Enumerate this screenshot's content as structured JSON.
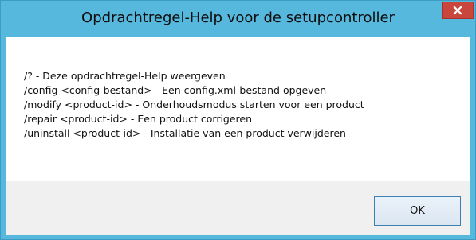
{
  "window": {
    "title": "Opdrachtregel-Help voor de setupcontroller"
  },
  "help": {
    "lines": [
      "/? - Deze opdrachtregel-Help weergeven",
      "/config <config-bestand> - Een config.xml-bestand opgeven",
      "/modify <product-id> - Onderhoudsmodus starten voor een product",
      "/repair <product-id> - Een product corrigeren",
      "/uninstall <product-id> - Installatie van een product verwijderen"
    ]
  },
  "buttons": {
    "ok_label": "OK",
    "close_icon": "close-icon"
  },
  "colors": {
    "titlebar": "#57b8de",
    "close_button": "#c9463d",
    "content_background": "#ffffff",
    "footer_background": "#f0f0f0"
  }
}
